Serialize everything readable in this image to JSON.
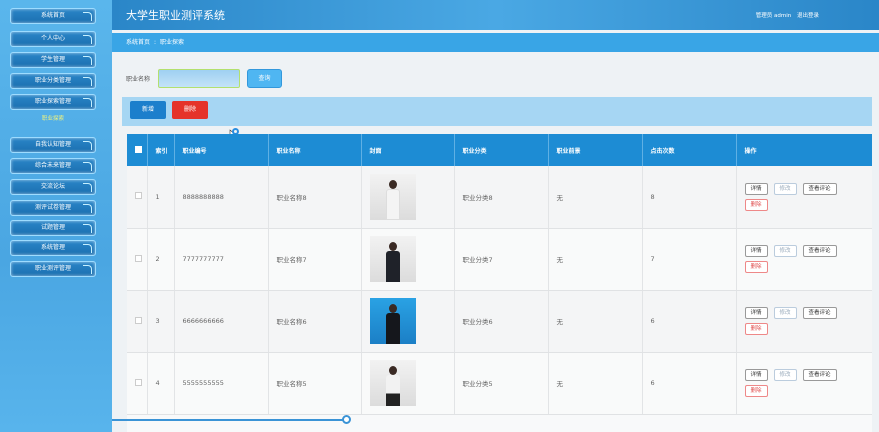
{
  "app": {
    "title": "大学生职业测评系统"
  },
  "user": {
    "admin_label": "管理员 admin",
    "logout": "退出登录"
  },
  "sidebar": {
    "items": [
      {
        "label": "系统首页"
      },
      {
        "label": "个人中心"
      },
      {
        "label": "学生管理"
      },
      {
        "label": "职业分类管理"
      },
      {
        "label": "职业探索管理"
      },
      {
        "label": "自我认知管理"
      },
      {
        "label": "综合未来管理"
      },
      {
        "label": "交流论坛"
      },
      {
        "label": "测评试卷管理"
      },
      {
        "label": "试题管理"
      },
      {
        "label": "系统管理"
      },
      {
        "label": "职业测评管理"
      }
    ],
    "sub_active": "职业探索"
  },
  "breadcrumb": {
    "home": "系统首页",
    "sep": ":",
    "current": "职业探索"
  },
  "search": {
    "label": "职业名称",
    "value": "",
    "button": "查询"
  },
  "actions": {
    "add": "新增",
    "delete": "删除"
  },
  "table": {
    "headers": [
      "索引",
      "职业编号",
      "职业名称",
      "封面",
      "职业分类",
      "职业前景",
      "点击次数",
      "操作"
    ],
    "rows": [
      {
        "index": "1",
        "code": "8888888888",
        "name": "职业名称8",
        "category": "职业分类8",
        "prospect": "无",
        "clicks": "8"
      },
      {
        "index": "2",
        "code": "7777777777",
        "name": "职业名称7",
        "category": "职业分类7",
        "prospect": "无",
        "clicks": "7"
      },
      {
        "index": "3",
        "code": "6666666666",
        "name": "职业名称6",
        "category": "职业分类6",
        "prospect": "无",
        "clicks": "6"
      },
      {
        "index": "4",
        "code": "5555555555",
        "name": "职业名称5",
        "category": "职业分类5",
        "prospect": "无",
        "clicks": "6"
      }
    ],
    "row_actions": {
      "detail": "详情",
      "edit": "修改",
      "comments": "查看评论",
      "delete": "删除"
    }
  },
  "colors": {
    "header_bg": "#1d8cd4",
    "accent": "#39a5e6",
    "danger": "#e5332a"
  }
}
